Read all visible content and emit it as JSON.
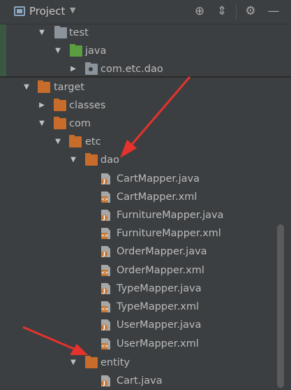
{
  "header": {
    "title": "Project"
  },
  "tree": [
    {
      "label": "test",
      "folder": "f-grey",
      "arrow": "down"
    },
    {
      "label": "java",
      "folder": "f-green",
      "arrow": "down"
    },
    {
      "label": "com.etc.dao",
      "folder": "f-pkg",
      "arrow": "right"
    },
    {
      "label": "target",
      "folder": "f-orange",
      "arrow": "down"
    },
    {
      "label": "classes",
      "folder": "f-orange",
      "arrow": "right"
    },
    {
      "label": "com",
      "folder": "f-orange",
      "arrow": "down"
    },
    {
      "label": "etc",
      "folder": "f-orange",
      "arrow": "down"
    },
    {
      "label": "dao",
      "folder": "f-orange",
      "arrow": "down"
    },
    {
      "label": "CartMapper.java",
      "file": "java"
    },
    {
      "label": "CartMapper.xml",
      "file": "xml"
    },
    {
      "label": "FurnitureMapper.java",
      "file": "java"
    },
    {
      "label": "FurnitureMapper.xml",
      "file": "xml"
    },
    {
      "label": "OrderMapper.java",
      "file": "java"
    },
    {
      "label": "OrderMapper.xml",
      "file": "xml"
    },
    {
      "label": "TypeMapper.java",
      "file": "java"
    },
    {
      "label": "TypeMapper.xml",
      "file": "xml"
    },
    {
      "label": "UserMapper.java",
      "file": "java"
    },
    {
      "label": "UserMapper.xml",
      "file": "xml"
    },
    {
      "label": "entity",
      "folder": "f-orange",
      "arrow": "down"
    },
    {
      "label": "Cart.java",
      "file": "java"
    }
  ],
  "colors": {
    "background": "#3c3f41",
    "annotation_arrow": "#e5322d"
  }
}
